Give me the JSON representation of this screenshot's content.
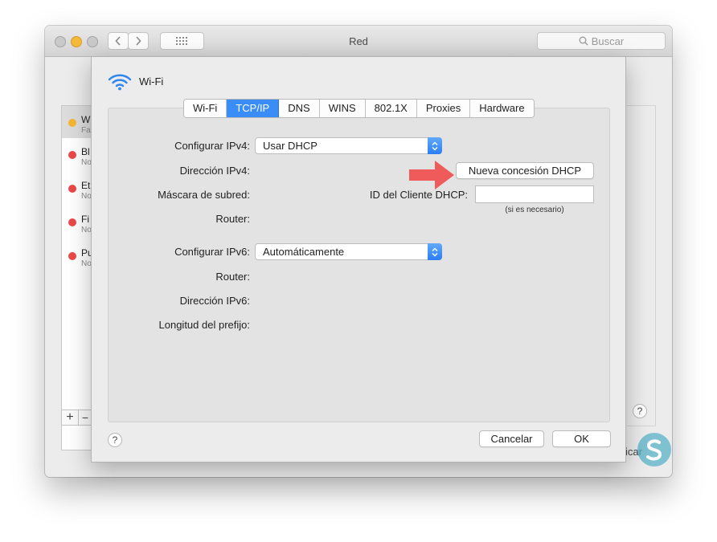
{
  "window": {
    "title": "Red"
  },
  "search": {
    "placeholder": "Buscar"
  },
  "services": [
    {
      "name": "W",
      "status": "Fa",
      "color": "#f5b731"
    },
    {
      "name": "Bl",
      "status": "No",
      "color": "#ec4848"
    },
    {
      "name": "Et",
      "status": "No",
      "color": "#ec4848"
    },
    {
      "name": "Fi",
      "status": "No",
      "color": "#ec4848"
    },
    {
      "name": "Pu",
      "status": "No",
      "color": "#ec4848"
    }
  ],
  "sidebar_controls": {
    "add": "+",
    "remove": "−"
  },
  "bg_apply_label": "icar",
  "sheet": {
    "interface_name": "Wi-Fi",
    "tabs": [
      "Wi-Fi",
      "TCP/IP",
      "DNS",
      "WINS",
      "802.1X",
      "Proxies",
      "Hardware"
    ],
    "active_tab": "TCP/IP",
    "ipv4": {
      "configure_label": "Configurar IPv4:",
      "configure_value": "Usar DHCP",
      "address_label": "Dirección IPv4:",
      "subnet_label": "Máscara de subred:",
      "router_label": "Router:",
      "renew_button": "Nueva concesión DHCP",
      "client_id_label": "ID del Cliente DHCP:",
      "client_id_value": "",
      "client_id_hint": "(si es necesario)"
    },
    "ipv6": {
      "configure_label": "Configurar IPv6:",
      "configure_value": "Automáticamente",
      "router_label": "Router:",
      "address_label": "Dirección IPv6:",
      "prefix_label": "Longitud del prefijo:"
    },
    "help_glyph": "?",
    "cancel_button": "Cancelar",
    "ok_button": "OK"
  },
  "colors": {
    "accent": "#3a8df6",
    "arrow": "#ef5a5a",
    "watermark": "#5ab3c8"
  }
}
